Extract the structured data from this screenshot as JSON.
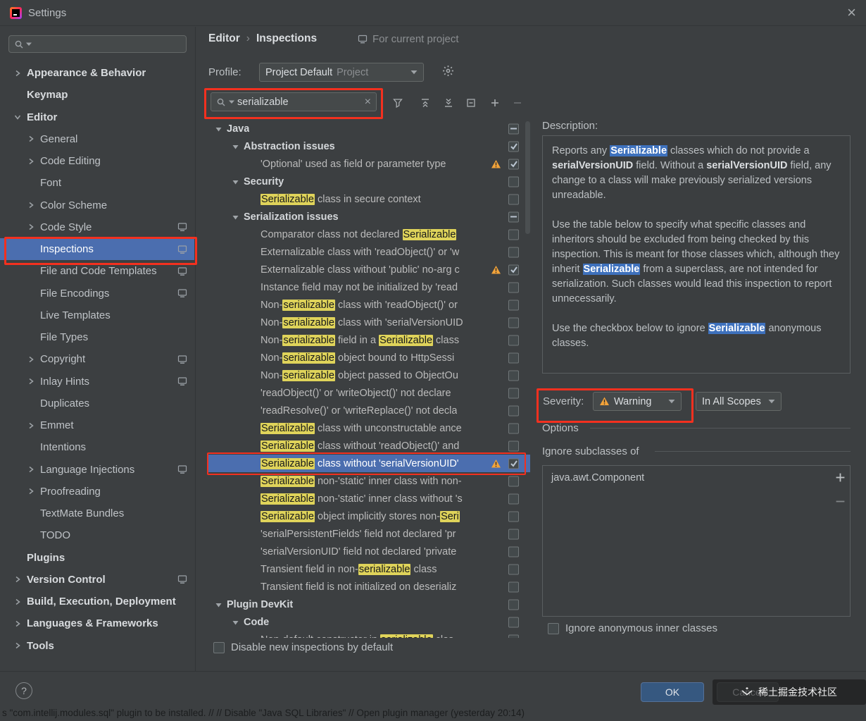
{
  "title_bar": {
    "title": "Settings"
  },
  "sidebar": {
    "items": [
      {
        "label": "Appearance & Behavior",
        "level": 0,
        "chevron": "collapsed",
        "bold": true
      },
      {
        "label": "Keymap",
        "level": 0,
        "bold": true
      },
      {
        "label": "Editor",
        "level": 0,
        "chevron": "expanded",
        "bold": true
      },
      {
        "label": "General",
        "level": 1,
        "chevron": "collapsed"
      },
      {
        "label": "Code Editing",
        "level": 1,
        "chevron": "collapsed"
      },
      {
        "label": "Font",
        "level": 1
      },
      {
        "label": "Color Scheme",
        "level": 1,
        "chevron": "collapsed"
      },
      {
        "label": "Code Style",
        "level": 1,
        "chevron": "collapsed",
        "badge": true
      },
      {
        "label": "Inspections",
        "level": 1,
        "selected": true,
        "badge": true
      },
      {
        "label": "File and Code Templates",
        "level": 1,
        "badge": true
      },
      {
        "label": "File Encodings",
        "level": 1,
        "badge": true
      },
      {
        "label": "Live Templates",
        "level": 1
      },
      {
        "label": "File Types",
        "level": 1
      },
      {
        "label": "Copyright",
        "level": 1,
        "chevron": "collapsed",
        "badge": true
      },
      {
        "label": "Inlay Hints",
        "level": 1,
        "chevron": "collapsed",
        "badge": true
      },
      {
        "label": "Duplicates",
        "level": 1
      },
      {
        "label": "Emmet",
        "level": 1,
        "chevron": "collapsed"
      },
      {
        "label": "Intentions",
        "level": 1
      },
      {
        "label": "Language Injections",
        "level": 1,
        "chevron": "collapsed",
        "badge": true
      },
      {
        "label": "Proofreading",
        "level": 1,
        "chevron": "collapsed"
      },
      {
        "label": "TextMate Bundles",
        "level": 1
      },
      {
        "label": "TODO",
        "level": 1
      },
      {
        "label": "Plugins",
        "level": 0,
        "bold": true
      },
      {
        "label": "Version Control",
        "level": 0,
        "chevron": "collapsed",
        "bold": true,
        "badge": true
      },
      {
        "label": "Build, Execution, Deployment",
        "level": 0,
        "chevron": "collapsed",
        "bold": true
      },
      {
        "label": "Languages & Frameworks",
        "level": 0,
        "chevron": "collapsed",
        "bold": true
      },
      {
        "label": "Tools",
        "level": 0,
        "chevron": "collapsed",
        "bold": true
      }
    ]
  },
  "header": {
    "section": "Editor",
    "separator": "›",
    "page": "Inspections",
    "scope_note": "For current project"
  },
  "profile": {
    "label": "Profile:",
    "value": "Project Default",
    "suffix": "Project"
  },
  "search": {
    "value": "serializable"
  },
  "toolbar": {
    "icons": [
      "filter",
      "collapse-all",
      "expand-all",
      "reset",
      "add",
      "remove"
    ]
  },
  "inspections": {
    "rows": [
      {
        "level": 0,
        "chevron": "expanded",
        "group": true,
        "checkbox": "indeterminate",
        "segments": [
          {
            "t": "Java"
          }
        ]
      },
      {
        "level": 1,
        "chevron": "expanded",
        "group": true,
        "checkbox": "checked",
        "segments": [
          {
            "t": "Abstraction issues"
          }
        ]
      },
      {
        "level": 2,
        "checkbox": "checked",
        "warning": true,
        "segments": [
          {
            "t": "'Optional' used as field or parameter type"
          }
        ]
      },
      {
        "level": 1,
        "chevron": "expanded",
        "group": true,
        "checkbox": "unchecked",
        "segments": [
          {
            "t": "Security"
          }
        ]
      },
      {
        "level": 2,
        "checkbox": "unchecked",
        "segments": [
          {
            "t": "Serializable",
            "h": true
          },
          {
            "t": " class in secure context"
          }
        ]
      },
      {
        "level": 1,
        "chevron": "expanded",
        "group": true,
        "checkbox": "indeterminate",
        "segments": [
          {
            "t": "Serialization issues"
          }
        ]
      },
      {
        "level": 2,
        "checkbox": "unchecked",
        "segments": [
          {
            "t": "Comparator class not declared "
          },
          {
            "t": "Serializable",
            "h": true
          }
        ]
      },
      {
        "level": 2,
        "checkbox": "unchecked",
        "segments": [
          {
            "t": "Externalizable class with 'readObject()' or 'w"
          }
        ]
      },
      {
        "level": 2,
        "checkbox": "checked",
        "warning": true,
        "segments": [
          {
            "t": "Externalizable class without 'public' no-arg c"
          }
        ]
      },
      {
        "level": 2,
        "checkbox": "unchecked",
        "segments": [
          {
            "t": "Instance field may not be initialized by 'read"
          }
        ]
      },
      {
        "level": 2,
        "checkbox": "unchecked",
        "segments": [
          {
            "t": "Non-"
          },
          {
            "t": "serializable",
            "h": true
          },
          {
            "t": " class with 'readObject()' or"
          }
        ]
      },
      {
        "level": 2,
        "checkbox": "unchecked",
        "segments": [
          {
            "t": "Non-"
          },
          {
            "t": "serializable",
            "h": true
          },
          {
            "t": " class with 'serialVersionUID"
          }
        ]
      },
      {
        "level": 2,
        "checkbox": "unchecked",
        "segments": [
          {
            "t": "Non-"
          },
          {
            "t": "serializable",
            "h": true
          },
          {
            "t": " field in a "
          },
          {
            "t": "Serializable",
            "h": true
          },
          {
            "t": " class"
          }
        ]
      },
      {
        "level": 2,
        "checkbox": "unchecked",
        "segments": [
          {
            "t": "Non-"
          },
          {
            "t": "serializable",
            "h": true
          },
          {
            "t": " object bound to HttpSessi"
          }
        ]
      },
      {
        "level": 2,
        "checkbox": "unchecked",
        "segments": [
          {
            "t": "Non-"
          },
          {
            "t": "serializable",
            "h": true
          },
          {
            "t": " object passed to ObjectOu"
          }
        ]
      },
      {
        "level": 2,
        "checkbox": "unchecked",
        "segments": [
          {
            "t": "'readObject()' or 'writeObject()' not declare"
          }
        ]
      },
      {
        "level": 2,
        "checkbox": "unchecked",
        "segments": [
          {
            "t": "'readResolve()' or 'writeReplace()' not decla"
          }
        ]
      },
      {
        "level": 2,
        "checkbox": "unchecked",
        "segments": [
          {
            "t": "Serializable",
            "h": true
          },
          {
            "t": " class with unconstructable ance"
          }
        ]
      },
      {
        "level": 2,
        "checkbox": "unchecked",
        "segments": [
          {
            "t": "Serializable",
            "h": true
          },
          {
            "t": " class without 'readObject()' and"
          }
        ]
      },
      {
        "level": 2,
        "checkbox": "checked",
        "warning": true,
        "selected": true,
        "segments": [
          {
            "t": "Serializable",
            "h": true
          },
          {
            "t": " class without 'serialVersionUID'"
          }
        ]
      },
      {
        "level": 2,
        "checkbox": "unchecked",
        "segments": [
          {
            "t": "Serializable",
            "h": true
          },
          {
            "t": " non-'static' inner class with non-"
          }
        ]
      },
      {
        "level": 2,
        "checkbox": "unchecked",
        "segments": [
          {
            "t": "Serializable",
            "h": true
          },
          {
            "t": " non-'static' inner class without 's"
          }
        ]
      },
      {
        "level": 2,
        "checkbox": "unchecked",
        "segments": [
          {
            "t": "Serializable",
            "h": true
          },
          {
            "t": " object implicitly stores non-"
          },
          {
            "t": "Seri",
            "h": true
          }
        ]
      },
      {
        "level": 2,
        "checkbox": "unchecked",
        "segments": [
          {
            "t": "'serialPersistentFields' field not declared 'pr"
          }
        ]
      },
      {
        "level": 2,
        "checkbox": "unchecked",
        "segments": [
          {
            "t": "'serialVersionUID' field not declared 'private"
          }
        ]
      },
      {
        "level": 2,
        "checkbox": "unchecked",
        "segments": [
          {
            "t": "Transient field in non-"
          },
          {
            "t": "serializable",
            "h": true
          },
          {
            "t": " class"
          }
        ]
      },
      {
        "level": 2,
        "checkbox": "unchecked",
        "segments": [
          {
            "t": "Transient field is not initialized on deserializ"
          }
        ]
      },
      {
        "level": 0,
        "chevron": "expanded",
        "group": true,
        "checkbox": "unchecked",
        "segments": [
          {
            "t": "Plugin DevKit"
          }
        ]
      },
      {
        "level": 1,
        "chevron": "expanded",
        "group": true,
        "checkbox": "unchecked",
        "segments": [
          {
            "t": "Code"
          }
        ]
      },
      {
        "level": 2,
        "checkbox": "unchecked",
        "segments": [
          {
            "t": "Non-default constructor in "
          },
          {
            "t": "serializable",
            "h": true
          },
          {
            "t": " clas"
          }
        ]
      }
    ]
  },
  "footer": {
    "disable_label": "Disable new inspections by default"
  },
  "description": {
    "label": "Description:",
    "paragraphs": [
      [
        {
          "t": "Reports any "
        },
        {
          "t": "Serializable",
          "s": "hl"
        },
        {
          "t": " classes which do not provide a "
        },
        {
          "t": "serialVersionUID",
          "s": "b"
        },
        {
          "t": " field. Without a "
        },
        {
          "t": "serialVersionUID",
          "s": "b"
        },
        {
          "t": " field, any change to a class will make previously serialized versions unreadable."
        }
      ],
      [
        {
          "t": "Use the table below to specify what specific classes and inheritors should be excluded from being checked by this inspection. This is meant for those classes which, although they inherit "
        },
        {
          "t": "Serializable",
          "s": "hl"
        },
        {
          "t": " from a superclass, are not intended for serialization. Such classes would lead this inspection to report unnecessarily."
        }
      ],
      [
        {
          "t": "Use the checkbox below to ignore "
        },
        {
          "t": "Serializable",
          "s": "hl"
        },
        {
          "t": " anonymous classes."
        }
      ]
    ]
  },
  "severity": {
    "label": "Severity:",
    "value": "Warning",
    "scope": "In All Scopes"
  },
  "options": {
    "heading": "Options",
    "subheading": "Ignore subclasses of",
    "items": [
      "java.awt.Component"
    ],
    "ignore_checkbox_label": "Ignore anonymous inner classes"
  },
  "buttons": {
    "ok": "OK",
    "cancel": "Cancel"
  },
  "watermark": {
    "text": "稀土掘金技术社区"
  },
  "status_line": "s \"com.intellij.modules.sql\" plugin to be installed. // // Disable \"Java SQL Libraries\" // Open plugin manager (yesterday 20:14)",
  "colors": {
    "selection": "#4b6eaf",
    "match_highlight": "#dfd35a",
    "description_highlight": "#3e71bd",
    "annotation": "#f3301f",
    "warning": "#f2a33a",
    "ok_button": "#365880"
  }
}
